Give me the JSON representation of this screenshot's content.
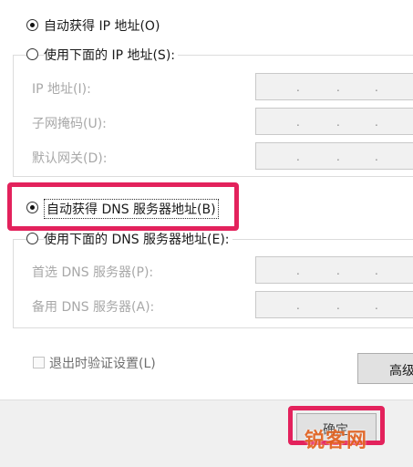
{
  "ip_section": {
    "auto_ip_label": "自动获得 IP 地址(O)",
    "manual_ip_label": "使用下面的 IP 地址(S):",
    "ip_address_label": "IP 地址(I):",
    "subnet_mask_label": "子网掩码(U):",
    "default_gateway_label": "默认网关(D):"
  },
  "dns_section": {
    "auto_dns_label": "自动获得 DNS 服务器地址(B)",
    "manual_dns_label": "使用下面的 DNS 服务器地址(E):",
    "preferred_dns_label": "首选 DNS 服务器(P):",
    "alternate_dns_label": "备用 DNS 服务器(A):"
  },
  "footer": {
    "validate_on_exit_label": "退出时验证设置(L)",
    "advanced_button_label": "高级",
    "ok_button_label": "确定"
  },
  "ip_separator": ".",
  "watermark": "锐客网",
  "colors": {
    "highlight": "#e3225c",
    "disabled_text": "#a8a8a8",
    "field_bg": "#f1f1f1",
    "footer_bg": "#f0f0f0"
  }
}
